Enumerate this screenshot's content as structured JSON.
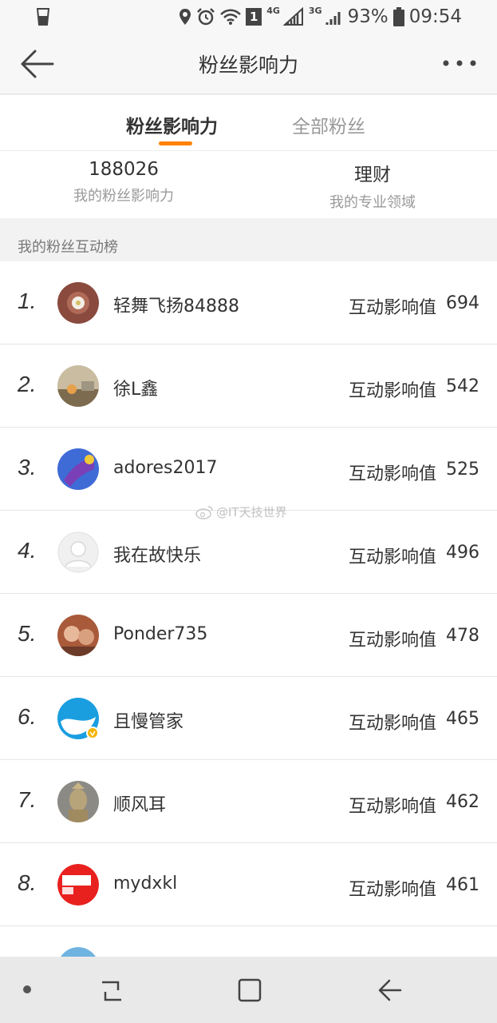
{
  "status_bar": {
    "battery": "93%",
    "time": "09:54",
    "sim_badge": "1",
    "network_1": "4G",
    "network_2": "3G",
    "icons": [
      "cup-icon",
      "location-icon",
      "alarm-icon",
      "wifi-icon",
      "signal-icon",
      "battery-icon"
    ]
  },
  "header": {
    "title": "粉丝影响力",
    "back_icon": "back-arrow-icon",
    "more_icon": "more-dots-icon"
  },
  "tabs": [
    {
      "label": "粉丝影响力",
      "active": true
    },
    {
      "label": "全部粉丝",
      "active": false
    }
  ],
  "summary": {
    "influence_value": "188026",
    "influence_label": "我的粉丝影响力",
    "domain_value": "理财",
    "domain_label": "我的专业领域"
  },
  "section": {
    "title": "我的粉丝互动榜"
  },
  "ranking": {
    "metric_label": "互动影响值",
    "rows": [
      {
        "rank": "1.",
        "name": "轻舞飞扬84888",
        "value": "694"
      },
      {
        "rank": "2.",
        "name": "徐L鑫",
        "value": "542"
      },
      {
        "rank": "3.",
        "name": "adores2017",
        "value": "525"
      },
      {
        "rank": "4.",
        "name": "我在故快乐",
        "value": "496"
      },
      {
        "rank": "5.",
        "name": "Ponder735",
        "value": "478"
      },
      {
        "rank": "6.",
        "name": "且慢管家",
        "value": "465"
      },
      {
        "rank": "7.",
        "name": "顺风耳",
        "value": "462"
      },
      {
        "rank": "8.",
        "name": "mydxkl",
        "value": "461"
      }
    ]
  },
  "watermark": "@IT天技世界",
  "colors": {
    "accent": "#ff8200",
    "text": "#333333",
    "muted": "#999999"
  }
}
